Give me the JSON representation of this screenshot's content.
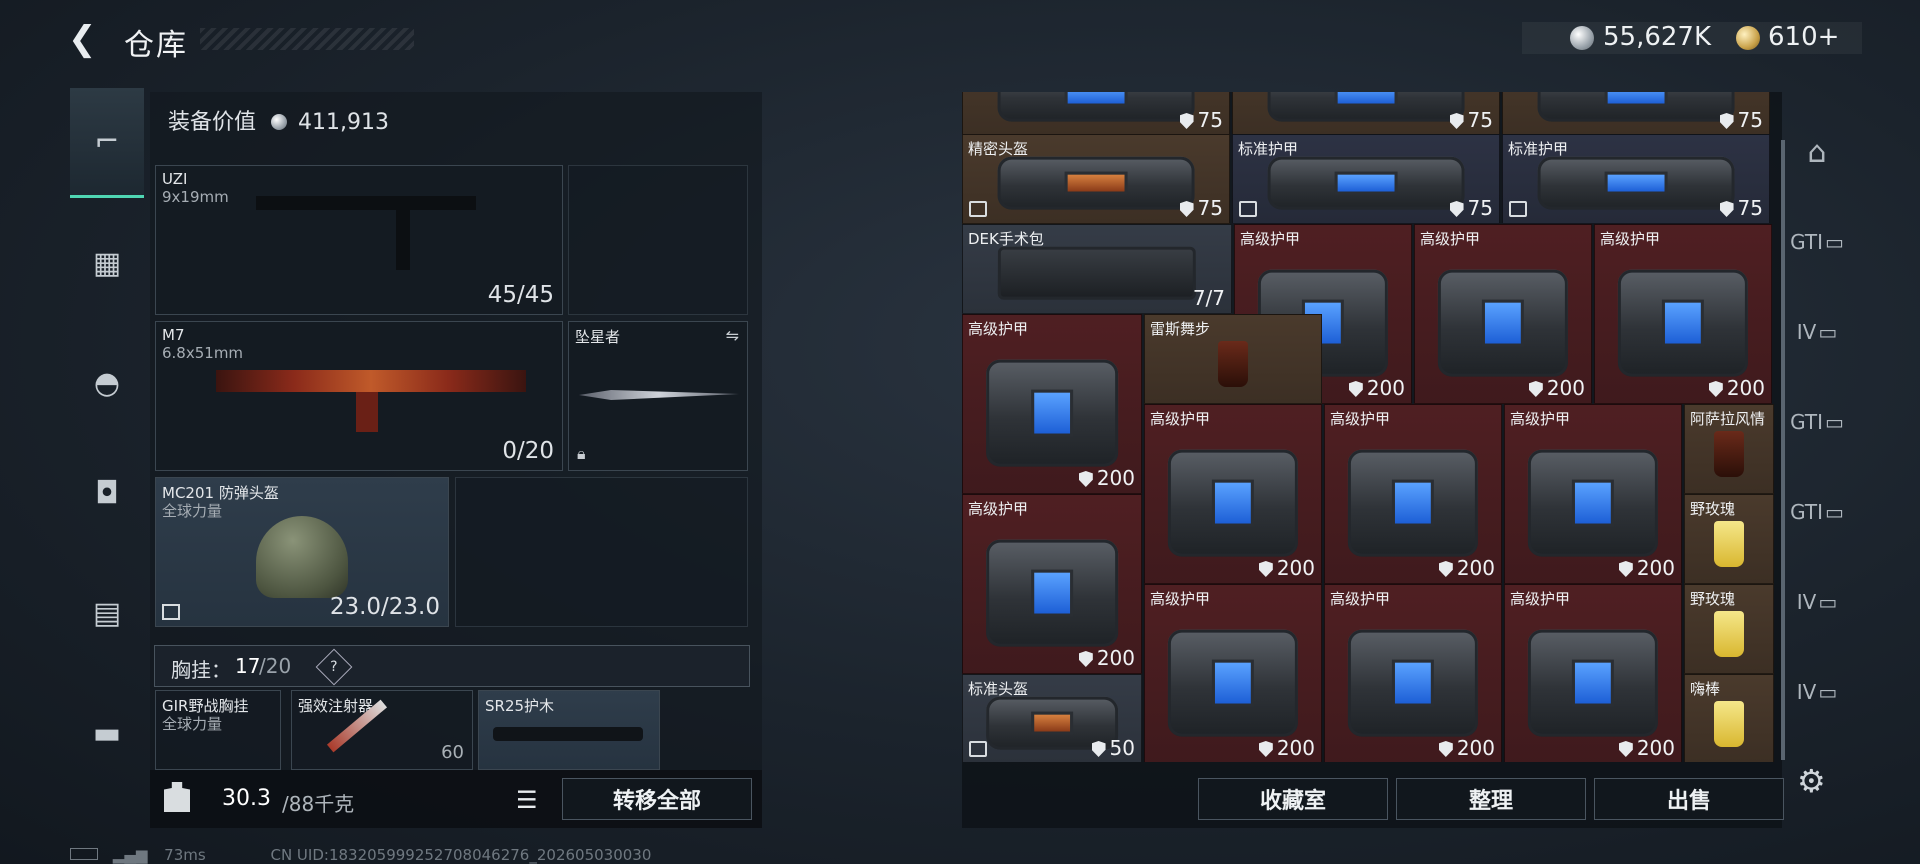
{
  "header": {
    "title": "仓库",
    "currency1": "55,627K",
    "currency2": "610+"
  },
  "equipment": {
    "value_label": "装备价值",
    "value": "411,913",
    "slots": [
      {
        "name": "UZI",
        "sub": "9x19mm",
        "count": "45/45"
      },
      {
        "name": "M7",
        "sub": "6.8x51mm",
        "count": "0/20"
      },
      {
        "name": "坠星者"
      },
      {
        "name": "MC201 防弹头盔",
        "sub": "全球力量",
        "count": "23.0/23.0"
      }
    ],
    "chest_label": "胸挂：",
    "chest_value": "17",
    "chest_max": "/20",
    "chest_help": "?",
    "chest_items": [
      {
        "name": "GIR野战胸挂",
        "sub": "全球力量"
      },
      {
        "name": "强效注射器",
        "count": "60"
      },
      {
        "name": "SR25护木"
      }
    ],
    "weight": "30.3",
    "weight_max": "/88千克",
    "transfer_all": "转移全部"
  },
  "grid": {
    "items": [
      {
        "label": "",
        "dur": "75",
        "color": "brown"
      },
      {
        "label": "",
        "dur": "75",
        "color": "brown"
      },
      {
        "label": "",
        "dur": "75",
        "color": "brown"
      },
      {
        "label": "精密头盔",
        "dur": "75",
        "color": "brown"
      },
      {
        "label": "标准护甲",
        "dur": "75",
        "color": "blue"
      },
      {
        "label": "标准护甲",
        "dur": "75",
        "color": "blue"
      },
      {
        "label": "DEK手术包",
        "dur": "7/7",
        "color": "gray"
      },
      {
        "label": "高级护甲",
        "dur": "200",
        "color": "red"
      },
      {
        "label": "高级护甲",
        "dur": "200",
        "color": "red"
      },
      {
        "label": "高级护甲",
        "dur": "200",
        "color": "red"
      },
      {
        "label": "高级护甲",
        "dur": "200",
        "color": "red"
      },
      {
        "label": "雷斯舞步",
        "dur": "",
        "color": "brown"
      },
      {
        "label": "高级护甲",
        "dur": "200",
        "color": "red"
      },
      {
        "label": "高级护甲",
        "dur": "200",
        "color": "red"
      },
      {
        "label": "高级护甲",
        "dur": "200",
        "color": "red"
      },
      {
        "label": "阿萨拉风情",
        "dur": "",
        "color": "brown"
      },
      {
        "label": "高级护甲",
        "dur": "200",
        "color": "red"
      },
      {
        "label": "野玫瑰",
        "dur": "",
        "color": "brown"
      },
      {
        "label": "高级护甲",
        "dur": "200",
        "color": "red"
      },
      {
        "label": "高级护甲",
        "dur": "200",
        "color": "red"
      },
      {
        "label": "高级护甲",
        "dur": "200",
        "color": "red"
      },
      {
        "label": "野玫瑰",
        "dur": "",
        "color": "brown"
      },
      {
        "label": "标准头盔",
        "dur": "50",
        "color": "gray"
      },
      {
        "label": "嗨棒",
        "dur": "",
        "color": "brown"
      }
    ],
    "btn_collection": "收藏室",
    "btn_sort": "整理",
    "btn_sell": "出售"
  },
  "right_tabs": [
    "GTI",
    "IV",
    "GTI",
    "GTI",
    "IV",
    "IV"
  ],
  "status": {
    "ping": "73ms",
    "uid": "CN UID:18320599925270804627​6_202605030030"
  }
}
